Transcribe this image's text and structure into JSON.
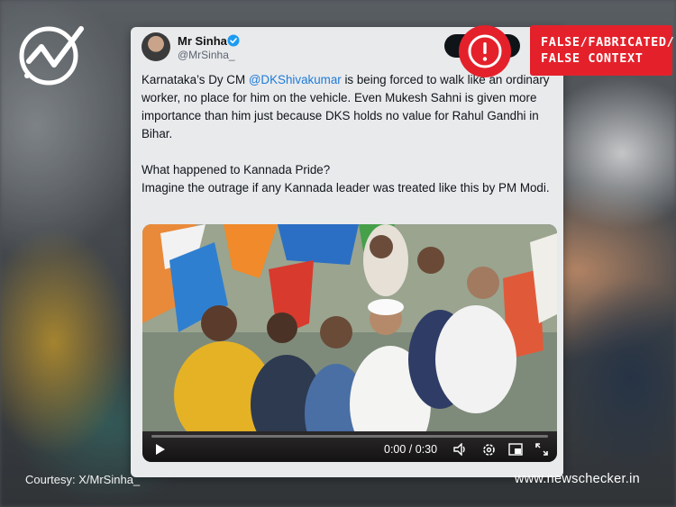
{
  "tweet": {
    "display_name": "Mr Sinha",
    "handle": "@MrSinha_",
    "text_before_mention": "Karnataka’s Dy CM ",
    "mention": "@DKShivakumar",
    "text_after_mention": " is being forced to walk like an ordinary worker, no place for him on the vehicle. Even Mukesh Sahni is given more importance than him just because DKS holds no value for Rahul Gandhi in Bihar.\n\nWhat happened to Kannada Pride?\nImagine the outrage if any Kannada leader was treated like this by PM Modi."
  },
  "video": {
    "time": "0:00 / 0:30",
    "progress": 0
  },
  "verdict": {
    "label": "FALSE/FABRICATED/\nFALSE CONTEXT"
  },
  "footer": {
    "courtesy": "Courtesy: X/MrSinha_",
    "site": "www.newschecker.in"
  },
  "colors": {
    "verdict_red": "#e4212b",
    "mention_blue": "#1d7bd8",
    "verified_blue": "#1d9bf0"
  },
  "icons": [
    "newschecker-logo-icon",
    "verified-badge-icon",
    "exclamation-icon",
    "play-icon",
    "volume-icon",
    "settings-icon",
    "pip-icon",
    "fullscreen-icon"
  ]
}
